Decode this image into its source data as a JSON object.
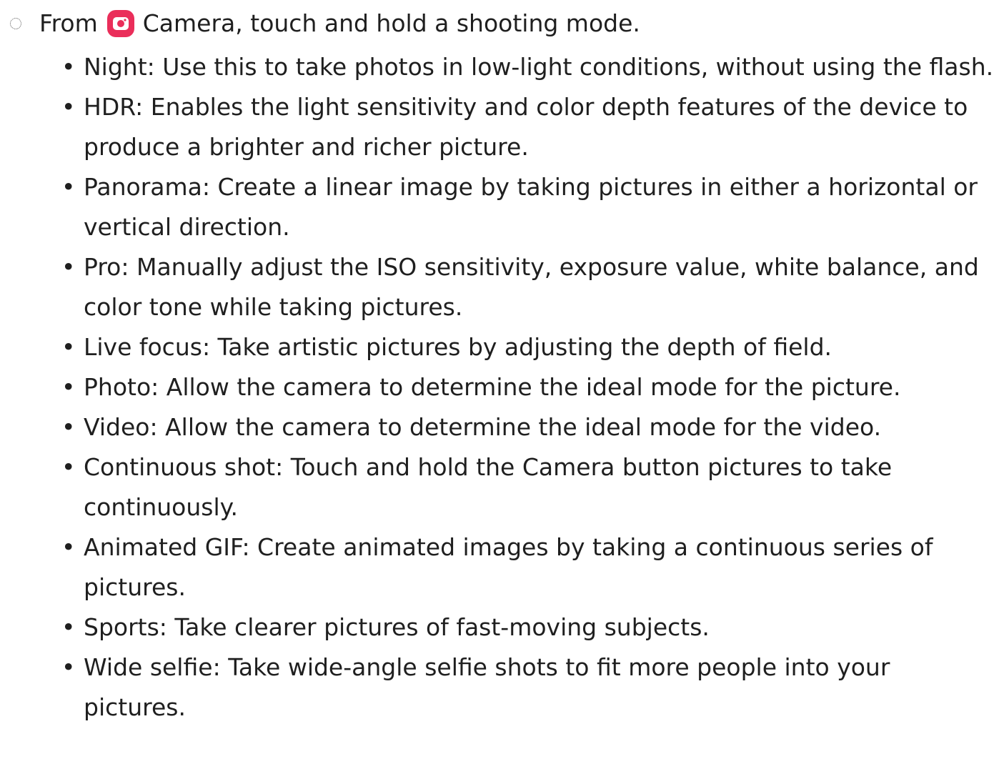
{
  "intro": {
    "prefix": "From",
    "app_name": "Camera",
    "suffix": ", touch and hold a shooting mode.",
    "app_icon": "camera-app-icon",
    "app_icon_color": "#EA2E5A"
  },
  "bullet_glyph": "•",
  "modes": [
    {
      "term": "Night",
      "desc": "Use this to take photos in low-light conditions, without using the flash."
    },
    {
      "term": "HDR",
      "desc": "Enables the light sensitivity and color depth features of the device to produce a brighter and richer picture."
    },
    {
      "term": "Panorama",
      "desc": "Create a linear image by taking pictures in either a horizontal or vertical direction."
    },
    {
      "term": "Pro",
      "desc": "Manually adjust the ISO sensitivity, exposure value, white balance, and color tone while taking pictures."
    },
    {
      "term": "Live focus",
      "desc": "Take artistic pictures by adjusting the depth of field."
    },
    {
      "term": "Photo",
      "desc": "Allow the camera to determine the ideal mode for the picture."
    },
    {
      "term": "Video",
      "desc": "Allow the camera to determine the ideal mode for the video."
    },
    {
      "term": "Continuous shot",
      "desc": "Touch and hold the Camera button pictures to take continuously."
    },
    {
      "term": "Animated GIF",
      "desc": "Create animated images by taking a continuous series of pictures."
    },
    {
      "term": "Sports",
      "desc": "Take clearer pictures of fast-moving subjects."
    },
    {
      "term": "Wide selfie",
      "desc": "Take wide-angle selfie shots to fit more people into your pictures."
    }
  ],
  "separator": ": "
}
